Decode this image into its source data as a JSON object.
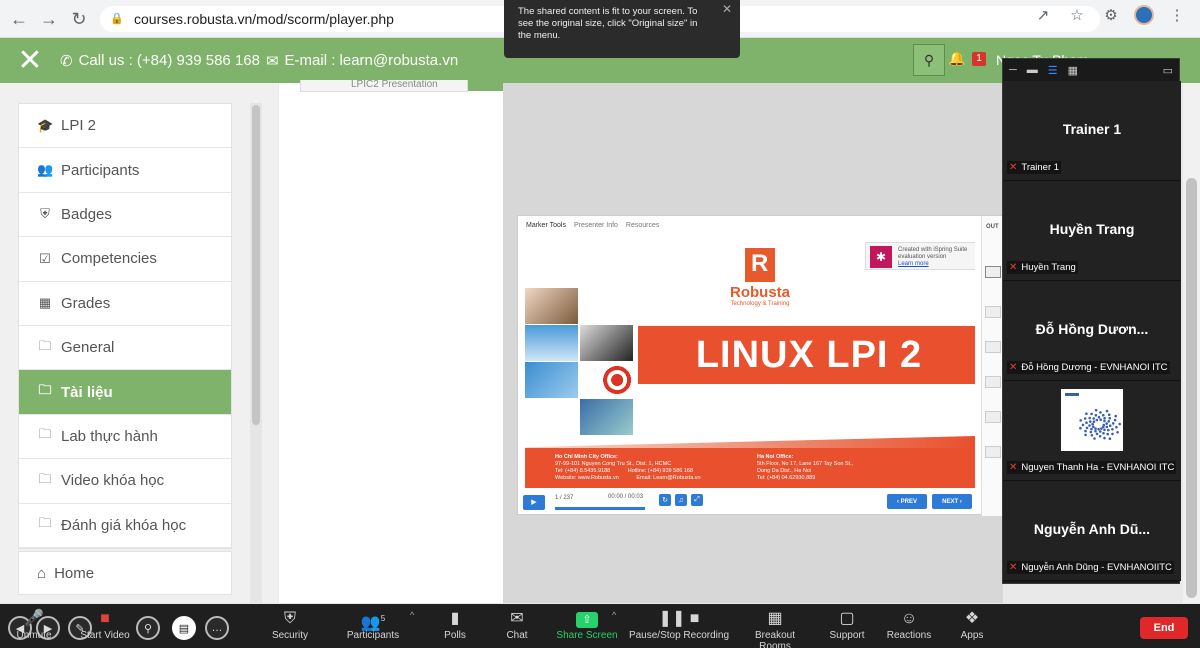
{
  "browser": {
    "url": "courses.robusta.vn/mod/scorm/player.php"
  },
  "header": {
    "phone": "Call us : (+84) 939 586 168",
    "email": "E-mail : learn@robusta.vn",
    "badge_count": "1",
    "username": "Ngoc Tu Pham"
  },
  "sidebar": {
    "items": [
      {
        "label": "LPI 2",
        "icon": "graduation-cap-icon"
      },
      {
        "label": "Participants",
        "icon": "users-icon"
      },
      {
        "label": "Badges",
        "icon": "shield-icon"
      },
      {
        "label": "Competencies",
        "icon": "checkbox-icon"
      },
      {
        "label": "Grades",
        "icon": "table-icon"
      },
      {
        "label": "General",
        "icon": "folder-icon"
      },
      {
        "label": "Tài liệu",
        "icon": "folder-icon",
        "active": true
      },
      {
        "label": "Lab thực hành",
        "icon": "folder-icon"
      },
      {
        "label": "Video khóa học",
        "icon": "folder-icon"
      },
      {
        "label": "Đánh giá khóa học",
        "icon": "folder-icon"
      }
    ],
    "home": "Home"
  },
  "content": {
    "tab_label": "LPIC2 Presentation"
  },
  "player": {
    "tabs": [
      "Marker Tools",
      "Presenter Info",
      "Resources"
    ],
    "ispring_line1": "Created with iSpring Suite",
    "ispring_line2": "evaluation version",
    "ispring_link": "Learn more",
    "logo_name": "Robusta",
    "logo_tagline": "Technology & Training",
    "slide_title": "LINUX LPI 2",
    "office_hcm_title": "Ho Chi Minh City Office:",
    "office_hcm_addr": "97-99-101 Nguyen Cong Tru St., Dist. 1, HCMC",
    "office_hcm_tel": "Tel: (+84) 8.5435.9188",
    "office_hcm_hotline": "Hotline: (+84) 939 586 168",
    "office_hcm_web": "Website: www.Robusta.vn",
    "office_hcm_email": "Email: Learn@Robusta.vn",
    "office_hn_title": "Ha Noi Office:",
    "office_hn_addr": "5th Floor, No 17, Lane 167 Tay Son St.,",
    "office_hn_dist": "Dong Da Dist., Ha Noi",
    "office_hn_tel": "Tel: (+84) 04.62930.889",
    "slide_counter": "1 / 237",
    "time": "00:00 / 00:03",
    "prev": "PREV",
    "next": "NEXT",
    "outline": "OUT"
  },
  "notice": {
    "text": "The shared content is fit to your screen. To see the original size, click \"Original size\" in the menu."
  },
  "gallery": {
    "participants": [
      {
        "display": "Trainer 1",
        "label": "Trainer 1"
      },
      {
        "display": "Huyền Trang",
        "label": "Huyền Trang"
      },
      {
        "display": "Đỗ Hồng Dươn...",
        "label": "Đỗ Hồng Dương - EVNHANOI ITC"
      },
      {
        "display": "",
        "label": "Nguyen Thanh Ha - EVNHANOI ITC"
      },
      {
        "display": "Nguyễn Anh Dũ...",
        "label": "Nguyễn Anh Dũng - EVNHANOIITC"
      }
    ]
  },
  "toolbar": {
    "unmute": "Unmute",
    "start_video": "Start Video",
    "security": "Security",
    "participants": "Participants",
    "participants_count": "5",
    "polls": "Polls",
    "chat": "Chat",
    "share_screen": "Share Screen",
    "recording": "Pause/Stop Recording",
    "breakout": "Breakout Rooms",
    "support": "Support",
    "reactions": "Reactions",
    "apps": "Apps",
    "end": "End"
  },
  "colors": {
    "brand_green": "#7fb26a",
    "slide_orange": "#e8502e",
    "player_blue": "#2d7bd6",
    "zoom_green": "#27d16b",
    "end_red": "#e02828"
  }
}
